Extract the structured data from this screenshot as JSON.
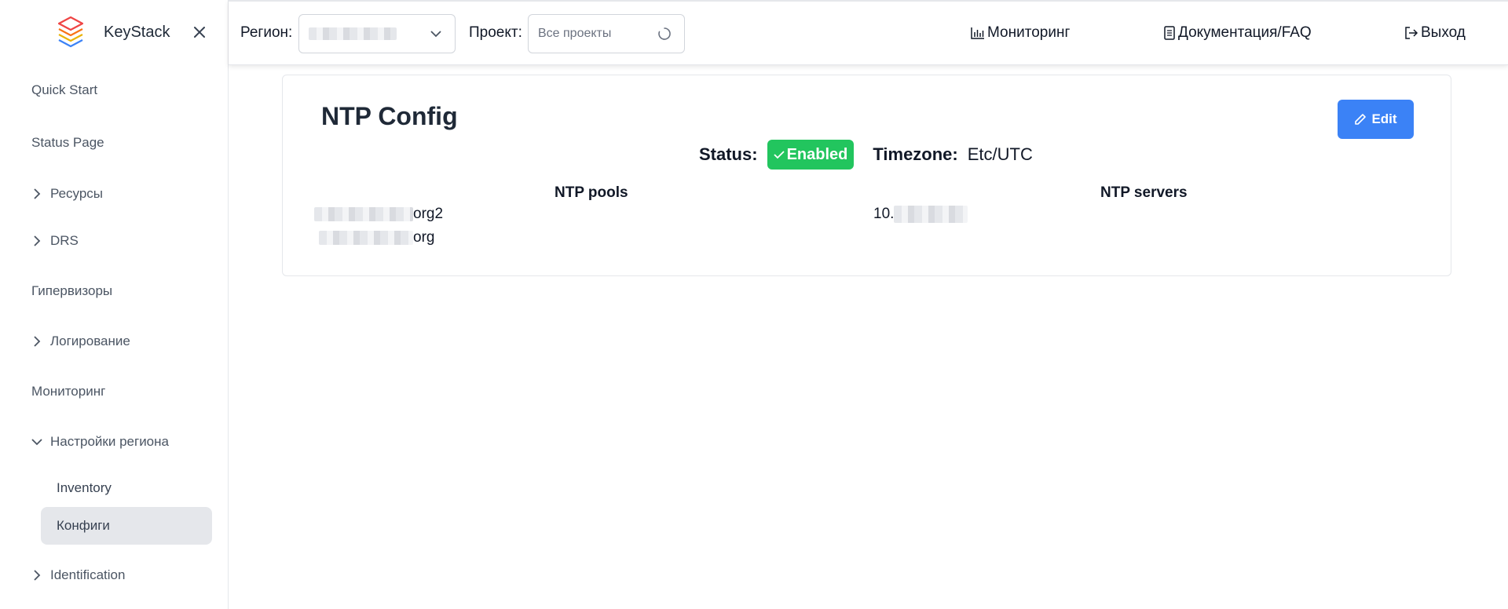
{
  "sidebar": {
    "brand_name": "KeyStack",
    "items": [
      {
        "label": "Quick Start"
      },
      {
        "label": "Status Page"
      },
      {
        "label": "Ресурсы"
      },
      {
        "label": "DRS"
      },
      {
        "label": "Гипервизоры"
      },
      {
        "label": "Логирование"
      },
      {
        "label": "Мониторинг"
      },
      {
        "label": "Настройки региона"
      },
      {
        "label": "Identification"
      }
    ],
    "subitems": [
      {
        "label": "Inventory"
      },
      {
        "label": "Конфиги",
        "active": true
      }
    ]
  },
  "topbar": {
    "region_label": "Регион:",
    "project_label": "Проект:",
    "project_placeholder": "Все проекты",
    "links": {
      "monitoring": "Мониторинг",
      "docs": "Документация/FAQ",
      "logout": "Выход"
    }
  },
  "card": {
    "title": "NTP Config",
    "edit_label": "Edit",
    "status_label": "Status:",
    "status_value": "Enabled",
    "timezone_label": "Timezone:",
    "timezone_value": "Etc/UTC",
    "pools_header": "NTP pools",
    "servers_header": "NTP servers",
    "pools": [
      {
        "suffix": "org2"
      },
      {
        "suffix": "org"
      }
    ],
    "servers": [
      {
        "prefix": "10."
      }
    ]
  },
  "colors": {
    "accent": "#3b82f6",
    "success": "#22c55e",
    "active_bg": "#e5e7eb"
  }
}
